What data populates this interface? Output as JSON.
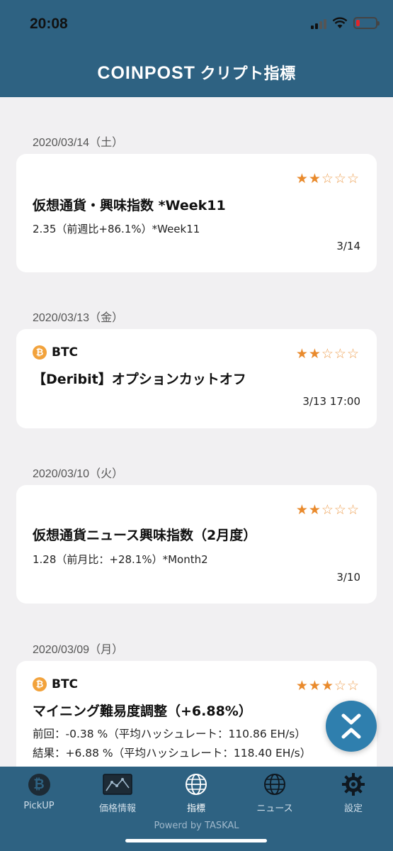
{
  "status_bar": {
    "time": "20:08"
  },
  "header": {
    "brand": "COINPOST",
    "title_suffix": "クリプト指標"
  },
  "sections": [
    {
      "date": "2020/03/14（土）",
      "card": {
        "stars": {
          "filled": "★★",
          "empty": "☆☆☆",
          "rating": 2,
          "max": 5
        },
        "title": "仮想通貨・興味指数 *Week11",
        "subtitle": "2.35（前週比+86.1%）*Week11",
        "date": "3/14"
      }
    },
    {
      "date": "2020/03/13（金）",
      "card": {
        "coin": "BTC",
        "coin_symbol": "₿",
        "stars": {
          "filled": "★★",
          "empty": "☆☆☆",
          "rating": 2,
          "max": 5
        },
        "title": "【Deribit】オプションカットオフ",
        "date": "3/13 17:00"
      }
    },
    {
      "date": "2020/03/10（火）",
      "card": {
        "stars": {
          "filled": "★★",
          "empty": "☆☆☆",
          "rating": 2,
          "max": 5
        },
        "title": "仮想通貨ニュース興味指数（2月度）",
        "subtitle": "1.28（前月比：+28.1%）*Month2",
        "date": "3/10"
      }
    },
    {
      "date": "2020/03/09（月）",
      "card": {
        "coin": "BTC",
        "coin_symbol": "₿",
        "stars": {
          "filled": "★★★",
          "empty": "☆☆",
          "rating": 3,
          "max": 5
        },
        "title": "マイニング難易度調整（+6.88%）",
        "line1": "前回：-0.38 %（平均ハッシュレート：110.86 EH/s）",
        "line2": "結果：+6.88 %（平均ハッシュレート：118.40 EH/s）"
      }
    }
  ],
  "tabs": [
    {
      "label": "PickUP",
      "icon": "bitcoin-icon"
    },
    {
      "label": "価格情報",
      "icon": "chart-icon"
    },
    {
      "label": "指標",
      "icon": "globe-icon",
      "active": true
    },
    {
      "label": "ニュース",
      "icon": "globe-icon"
    },
    {
      "label": "設定",
      "icon": "gear-icon"
    }
  ],
  "footer": {
    "powered": "Powerd by TASKAL"
  },
  "colors": {
    "header": "#2e6282",
    "accent_star": "#e98a2c",
    "fab": "#2f7fae",
    "bitcoin": "#f2a23b"
  }
}
